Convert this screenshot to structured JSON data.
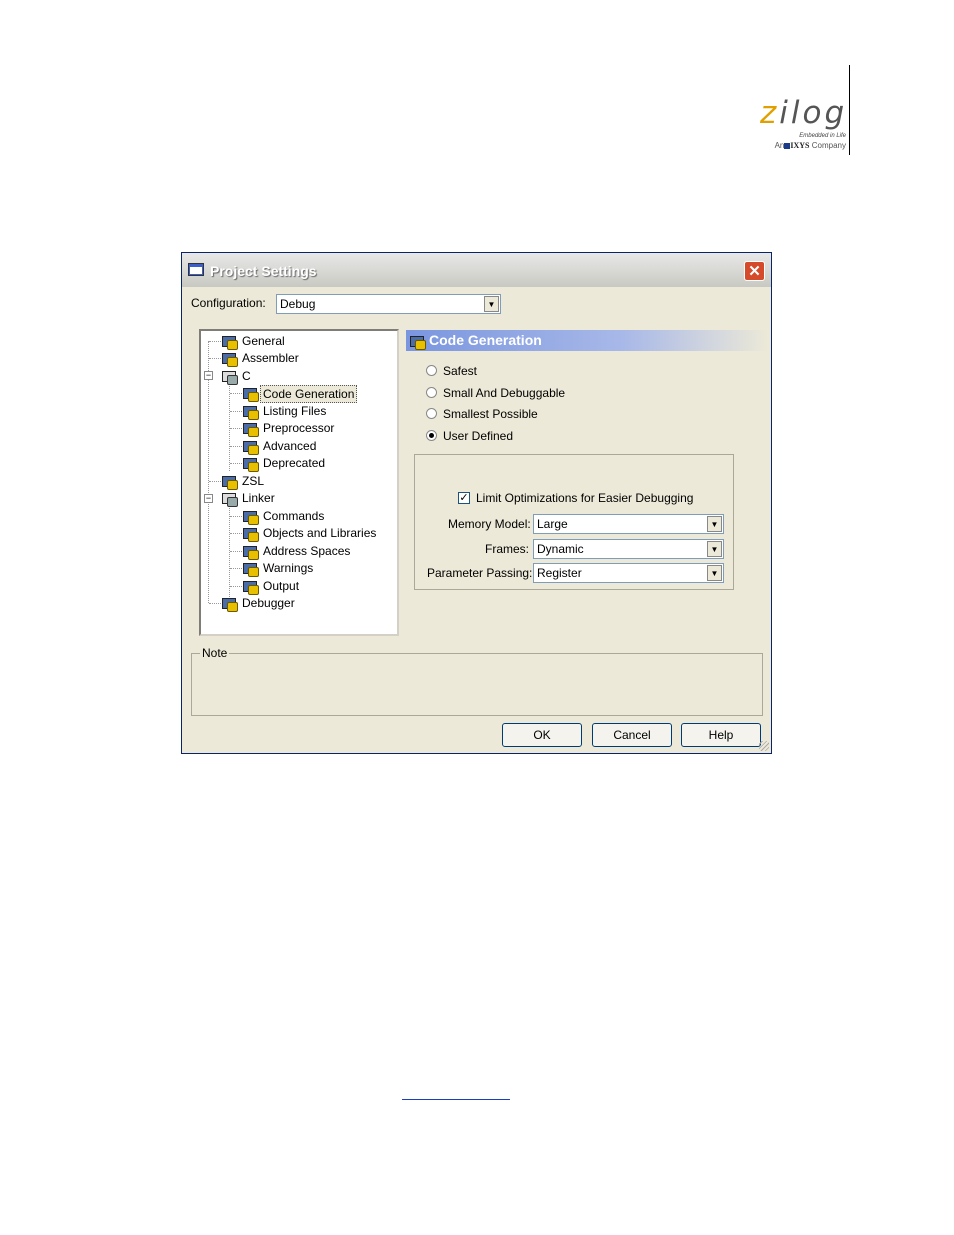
{
  "logo": {
    "word_z": "z",
    "word_rest": "ilog",
    "tagline": "Embedded in Life",
    "company_prefix": "An",
    "company_name": "IXYS",
    "company_suffix": "Company"
  },
  "dialog": {
    "title": "Project Settings",
    "close_label": "✕",
    "configuration_label": "Configuration:",
    "configuration_value": "Debug",
    "tree": [
      "General",
      "Assembler",
      "C",
      "Code Generation",
      "Listing Files",
      "Preprocessor",
      "Advanced",
      "Deprecated",
      "ZSL",
      "Linker",
      "Commands",
      "Objects and Libraries",
      "Address Spaces",
      "Warnings",
      "Output",
      "Debugger"
    ],
    "tree_selected": "Code Generation",
    "panel_title": "Code Generation",
    "radios": [
      "Safest",
      "Small And Debuggable",
      "Smallest Possible",
      "User Defined"
    ],
    "radio_selected": "User Defined",
    "checkbox_label": "Limit Optimizations for Easier Debugging",
    "checkbox_checked": true,
    "memory_model_label": "Memory Model:",
    "memory_model_value": "Large",
    "frames_label": "Frames:",
    "frames_value": "Dynamic",
    "param_label": "Parameter Passing:",
    "param_value": "Register",
    "note_label": "Note",
    "buttons": {
      "ok": "OK",
      "cancel": "Cancel",
      "help": "Help"
    }
  }
}
